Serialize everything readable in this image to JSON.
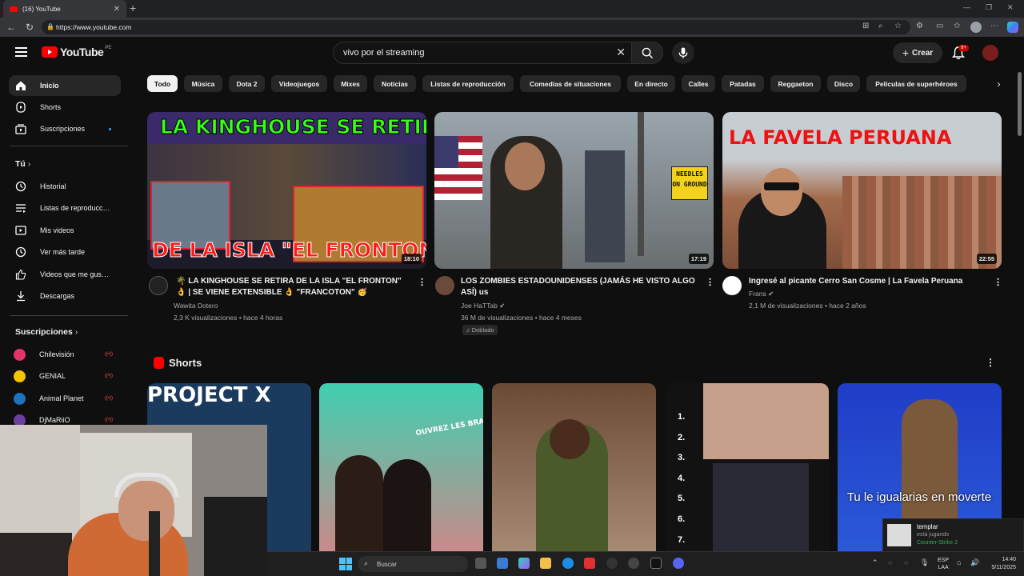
{
  "browser": {
    "tab_title": "(16) YouTube",
    "url": "https://www.youtube.com"
  },
  "header": {
    "logo_text": "YouTube",
    "region": "PE",
    "search_value": "vivo por el streaming",
    "create_label": "Crear",
    "notifications_badge": "9+"
  },
  "sidebar": {
    "main": [
      {
        "label": "Inicio",
        "icon": "home-icon",
        "active": true
      },
      {
        "label": "Shorts",
        "icon": "shorts-icon"
      },
      {
        "label": "Suscripciones",
        "icon": "subscriptions-icon"
      }
    ],
    "you_heading": "Tú",
    "you": [
      {
        "label": "Historial",
        "icon": "history-icon"
      },
      {
        "label": "Listas de reproducc…",
        "icon": "playlist-icon"
      },
      {
        "label": "Mis videos",
        "icon": "my-videos-icon"
      },
      {
        "label": "Ver más tarde",
        "icon": "clock-icon"
      },
      {
        "label": "Videos que me gus…",
        "icon": "thumbs-up-icon"
      },
      {
        "label": "Descargas",
        "icon": "download-icon"
      }
    ],
    "subs_heading": "Suscripciones",
    "subs": [
      {
        "label": "Chilevisión",
        "color": "#e5336a"
      },
      {
        "label": "GENIAL",
        "color": "#f5c400"
      },
      {
        "label": "Animal Planet",
        "color": "#1e73be"
      },
      {
        "label": "DjMaRiiO",
        "color": "#6b3fa0"
      }
    ]
  },
  "chips": [
    "Todo",
    "Música",
    "Dota 2",
    "Videojuegos",
    "Mixes",
    "Noticias",
    "Listas de reproducción",
    "Comedias de situaciones",
    "En directo",
    "Calles",
    "Patadas",
    "Reggaeton",
    "Disco",
    "Películas de superhéroes"
  ],
  "videos": [
    {
      "thumb_text_top": "LA KINGHOUSE SE RETIRA",
      "thumb_text_bottom": "DE LA ISLA \"EL FRONTON\"",
      "duration": "18:10",
      "title_line1": "🌴 LA KINGHOUSE SE RETIRA DE LA ISLA \"EL FRONTON\"",
      "title_line2": "👌 | SE VIENE EXTENSIBLE 👌 \"FRANCOTON\" 🥳",
      "channel": "Wawita Dotero",
      "stats": "2,3 K visualizaciones • hace 4 horas"
    },
    {
      "thumb_text_sign": "NEEDLES ON GROUND",
      "duration": "17:19",
      "title_line1": "LOS ZOMBIES ESTADOUNIDENSES (JAMÁS HE VISTO ALGO",
      "title_line2": "ASÍ) us",
      "channel": "Joe HaTTab",
      "stats": "36 M de visualizaciones • hace 4 meses",
      "tag": "Doblado"
    },
    {
      "thumb_text_top": "LA FAVELA PERUANA",
      "duration": "22:55",
      "title_line1": "Ingresé al picante Cerro San Cosme | La Favela Peruana",
      "channel": "Frans",
      "stats": "2,1 M de visualizaciones • hace 2 años"
    }
  ],
  "shorts": {
    "heading": "Shorts",
    "items": [
      {
        "overlay": "PROJECT X"
      },
      {
        "overlay": "OUVREZ LES BRAS"
      },
      {
        "overlay": ""
      },
      {
        "overlay": "1. 2. 3. 4. 5. 6. 7."
      },
      {
        "overlay": "Tu le igualarias en moverte"
      }
    ]
  },
  "taskbar": {
    "search_placeholder": "Buscar",
    "lang_line1": "ESP",
    "lang_line2": "LAA",
    "time": "14:40",
    "date": "5/11/2025"
  },
  "toast": {
    "name": "templar",
    "status": "está jugando",
    "game": "Counter-Strike 2"
  }
}
